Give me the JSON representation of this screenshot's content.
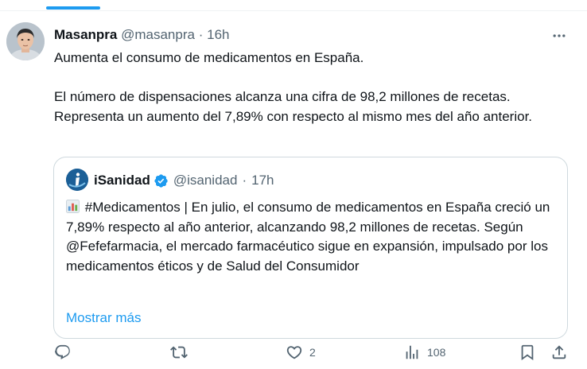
{
  "tweet": {
    "author_name": "Masanpra",
    "author_handle": "@masanpra",
    "separator": "·",
    "time": "16h",
    "text_line1": "Aumenta el consumo de medicamentos en España.",
    "text_para2": "El número de dispensaciones alcanza una cifra de 98,2 millones de recetas. Representa un aumento del 7,89% con respecto al mismo mes del año anterior."
  },
  "quote": {
    "author_name": "iSanidad",
    "author_handle": "@isanidad",
    "separator": "·",
    "time": "17h",
    "text": "#Medicamentos | En julio, el consumo de medicamentos en España creció un 7,89% respecto al año anterior, alcanzando 98,2 millones de recetas. Según @Fefefarmacia, el mercado farmacéutico sigue en expansión, impulsado por los medicamentos éticos y de Salud del Consumidor",
    "show_more": "Mostrar más"
  },
  "actions": {
    "reply_count": "",
    "retweet_count": "",
    "like_count": "2",
    "views_count": "108"
  },
  "colors": {
    "accent": "#1d9bf0",
    "secondary_text": "#536471",
    "border": "#cfd9de"
  },
  "icons": {
    "more": "more-icon",
    "verified": "verified-badge-icon",
    "reply": "reply-icon",
    "retweet": "retweet-icon",
    "like": "heart-icon",
    "views": "views-chart-icon",
    "bookmark": "bookmark-icon",
    "share": "share-icon"
  }
}
